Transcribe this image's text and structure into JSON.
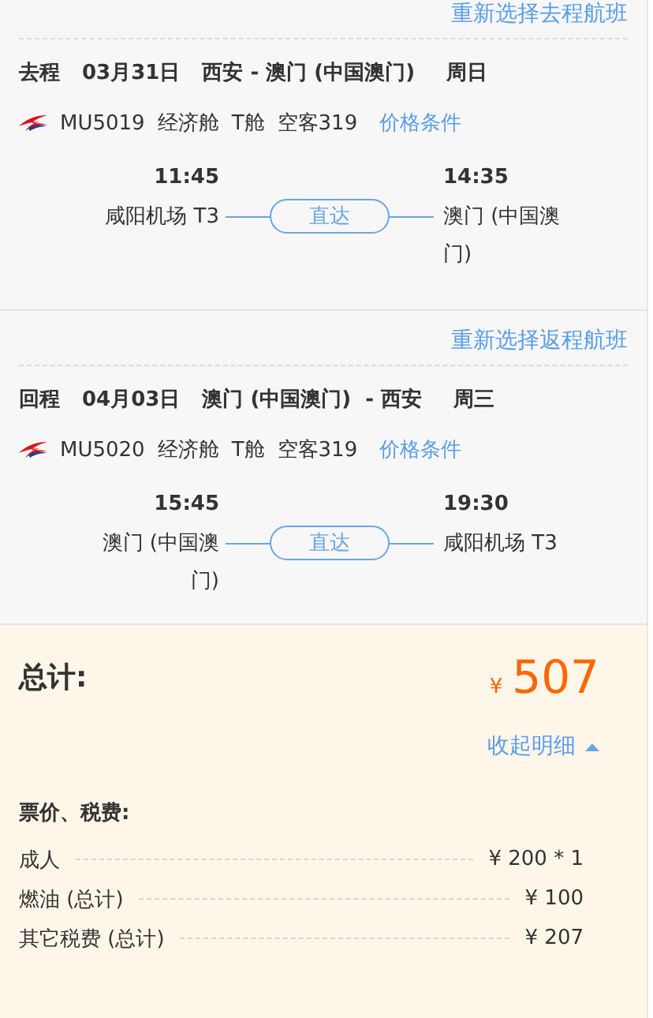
{
  "segments": [
    {
      "reselect_link": "重新选择去程航班",
      "direction": "去程",
      "date": "03月31日",
      "route": "西安 - 澳门 (中国澳门)",
      "weekday": "周日",
      "flight_no": "MU5019",
      "cabin": "经济舱",
      "cabin_code": "T舱",
      "aircraft": "空客319",
      "price_rules_link": "价格条件",
      "depart_time": "11:45",
      "depart_airport": "咸阳机场 T3",
      "stop_label": "直达",
      "arrive_time": "14:35",
      "arrive_airport": "澳门 (中国澳门)"
    },
    {
      "reselect_link": "重新选择返程航班",
      "direction": "回程",
      "date": "04月03日",
      "route": "澳门 (中国澳门)  - 西安",
      "weekday": "周三",
      "flight_no": "MU5020",
      "cabin": "经济舱",
      "cabin_code": "T舱",
      "aircraft": "空客319",
      "price_rules_link": "价格条件",
      "depart_time": "15:45",
      "depart_airport": "澳门 (中国澳门)",
      "stop_label": "直达",
      "arrive_time": "19:30",
      "arrive_airport": "咸阳机场 T3"
    }
  ],
  "total": {
    "label": "总计:",
    "currency": "¥",
    "amount": "507",
    "toggle_link": "收起明细",
    "expanded": true
  },
  "breakdown": {
    "title": "票价、税费:",
    "rows": [
      {
        "label": "成人",
        "value": "¥ 200 * 1"
      },
      {
        "label": "燃油 (总计)",
        "value": "¥ 100"
      },
      {
        "label": "其它税费 (总计)",
        "value": "¥ 207"
      }
    ]
  }
}
